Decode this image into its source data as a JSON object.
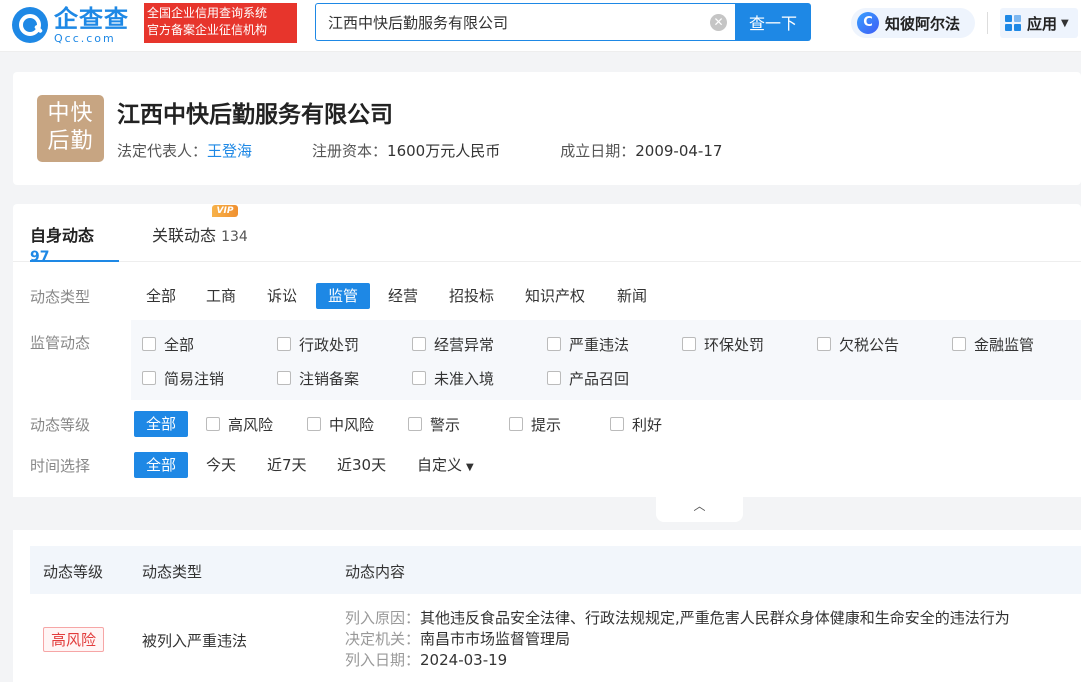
{
  "header": {
    "logo_cn": "企查查",
    "logo_en": "Qcc.com",
    "slogan_line1": "全国企业信用查询系统",
    "slogan_line2": "官方备案企业征信机构",
    "search_value": "江西中快后勤服务有限公司",
    "search_button": "查一下",
    "ai_label": "知彼阿尔法",
    "app_label": "应用"
  },
  "company": {
    "logo_text": "中快后勤",
    "name": "江西中快后勤服务有限公司",
    "legal_rep_label": "法定代表人：",
    "legal_rep": "王登海",
    "capital_label": "注册资本：",
    "capital": "1600万元人民币",
    "founded_label": "成立日期：",
    "founded": "2009-04-17"
  },
  "tabs": [
    {
      "label": "自身动态",
      "count": "97"
    },
    {
      "label": "关联动态",
      "count": "134",
      "badge": "VIP"
    }
  ],
  "filters": {
    "type_label": "动态类型",
    "types": [
      "全部",
      "工商",
      "诉讼",
      "监管",
      "经营",
      "招投标",
      "知识产权",
      "新闻"
    ],
    "active_type": "监管",
    "supervision_label": "监管动态",
    "supervision_row1": [
      "全部",
      "行政处罚",
      "经营异常",
      "严重违法",
      "环保处罚",
      "欠税公告",
      "金融监管"
    ],
    "supervision_row2": [
      "简易注销",
      "注销备案",
      "未准入境",
      "产品召回"
    ],
    "level_label": "动态等级",
    "level_all": "全部",
    "levels": [
      "高风险",
      "中风险",
      "警示",
      "提示",
      "利好"
    ],
    "time_label": "时间选择",
    "time_all": "全部",
    "times": [
      "今天",
      "近7天",
      "近30天"
    ],
    "time_custom": "自定义"
  },
  "table": {
    "headers": [
      "动态等级",
      "动态类型",
      "动态内容"
    ],
    "rows": [
      {
        "level": "高风险",
        "type": "被列入严重违法",
        "reason_label": "列入原因：",
        "reason": "其他违反食品安全法律、行政法规规定,严重危害人民群众身体健康和生命安全的违法行为",
        "authority_label": "决定机关：",
        "authority": "南昌市市场监督管理局",
        "date_label": "列入日期：",
        "date": "2024-03-19"
      }
    ]
  },
  "colors": {
    "accent": "#1e88e5",
    "danger": "#e23c3c",
    "slogan_bg": "#e7352c",
    "logo_bg": "#c7a582"
  }
}
